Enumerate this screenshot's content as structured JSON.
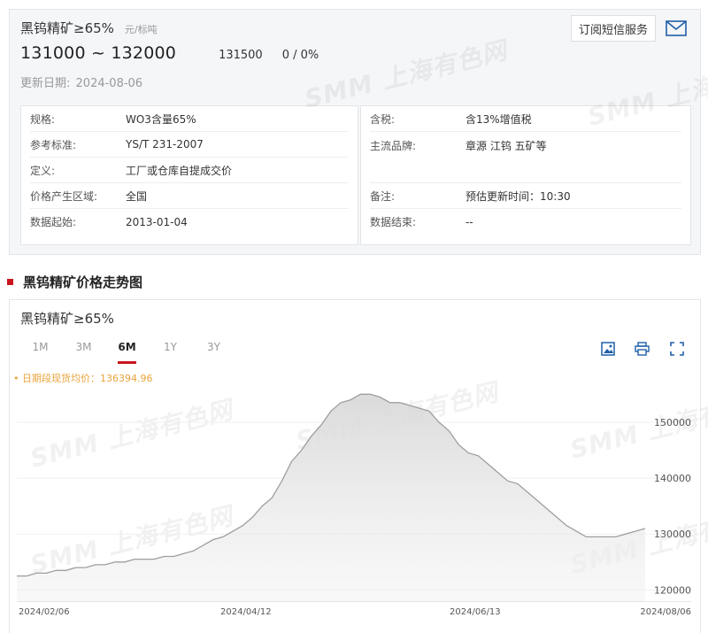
{
  "product": {
    "name": "黑钨精矿≥65%",
    "unit": "元/标吨",
    "price_range": "131000 ~ 132000",
    "avg_price": "131500",
    "change": "0 / 0%",
    "update_label": "更新日期:",
    "update_date": "2024-08-06",
    "subscribe_label": "订阅短信服务"
  },
  "specs": {
    "left": [
      {
        "key": "规格:",
        "value": "WO3含量65%"
      },
      {
        "key": "参考标准:",
        "value": "YS/T 231-2007"
      },
      {
        "key": "定义:",
        "value": "工厂或仓库自提成交价"
      },
      {
        "key": "价格产生区域:",
        "value": "全国"
      },
      {
        "key": "数据起始:",
        "value": "2013-01-04"
      }
    ],
    "right": [
      {
        "key": "含税:",
        "value": "含13%增值税"
      },
      {
        "key": "主流品牌:",
        "value": "章源 江钨 五矿等"
      },
      {
        "key": "备注:",
        "value": "预估更新时间：10:30"
      },
      {
        "key": "数据结束:",
        "value": "--"
      }
    ]
  },
  "section_title": "黑钨精矿价格走势图",
  "chart_panel": {
    "title": "黑钨精矿≥65%",
    "range_tabs": [
      "1M",
      "3M",
      "6M",
      "1Y",
      "3Y"
    ],
    "active_tab": "6M",
    "avg_label": "• 日期段现货均价：136394.96",
    "watermark": "SMM 上海有色网",
    "icons": [
      "download-image-icon",
      "print-icon",
      "fullscreen-icon"
    ]
  },
  "colors": {
    "accent_red": "#c9161d",
    "avg_label": "#e8a33b",
    "line": "#9e9e9e"
  },
  "chart_data": {
    "type": "area",
    "title": "黑钨精矿≥65%",
    "xlabel": "",
    "ylabel": "",
    "x_ticks": [
      "2024/02/06",
      "2024/04/12",
      "2024/06/13",
      "2024/08/06"
    ],
    "y_ticks": [
      120000,
      130000,
      140000,
      150000
    ],
    "ylim": [
      118000,
      156000
    ],
    "legend": "none",
    "grid": true,
    "series": [
      {
        "values": [
          122500,
          122500,
          123000,
          123000,
          123500,
          123500,
          124000,
          124000,
          124500,
          124500,
          125000,
          125000,
          125500,
          125500,
          125500,
          126000,
          126000,
          126500,
          127000,
          128000,
          129000,
          129500,
          130500,
          131500,
          133000,
          135000,
          136500,
          139500,
          143000,
          145000,
          147500,
          149500,
          152000,
          153500,
          154000,
          155000,
          155000,
          154500,
          153500,
          153500,
          153000,
          152500,
          152000,
          150000,
          148500,
          146000,
          144500,
          144000,
          142500,
          141000,
          139500,
          139000,
          137500,
          136000,
          134500,
          133000,
          131500,
          130500,
          129500,
          129500,
          129500,
          129500,
          130000,
          130500,
          131000
        ]
      }
    ]
  }
}
